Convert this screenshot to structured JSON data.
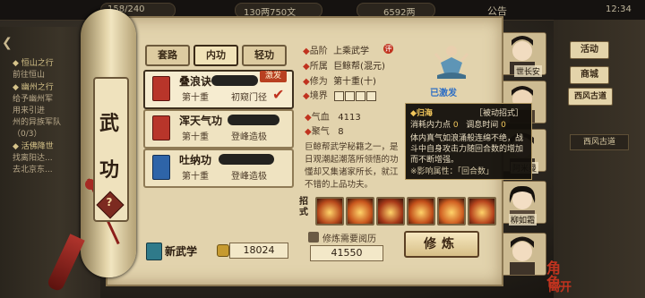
{
  "top_bar": {
    "resource_1": "158/240",
    "resource_2": "130两750文",
    "resource_3": "6592两",
    "announcement": "公告",
    "clock": "12:34"
  },
  "quest_panel": {
    "lines": [
      {
        "title": "◆ 恒山之行",
        "sub": "前往恒山"
      },
      {
        "title": "◆ 幽州之行",
        "sub": "给予幽州军"
      },
      {
        "title": "",
        "sub": "用来引进"
      },
      {
        "title": "",
        "sub": "州的异族军队"
      },
      {
        "title": "",
        "sub": "（0/3）"
      },
      {
        "title": "◆ 活佛降世",
        "sub": "找离阳达..."
      },
      {
        "title": "",
        "sub": "去北京东..."
      }
    ]
  },
  "scroll": {
    "vertical_title": [
      "武",
      "功"
    ],
    "help": "?"
  },
  "tabs": [
    {
      "label": "套路",
      "active": false
    },
    {
      "label": "内功",
      "active": true
    },
    {
      "label": "轻功",
      "active": false
    }
  ],
  "skills": [
    {
      "name": "叠浪诀",
      "tier": "第十重",
      "rank": "初窥门径",
      "badge": "激发",
      "book_color": "#b8352a",
      "selected": true
    },
    {
      "name": "浑天气功",
      "tier": "第十重",
      "rank": "登峰造极",
      "badge": "",
      "book_color": "#b8352a",
      "selected": false
    },
    {
      "name": "吐纳功",
      "tier": "第十重",
      "rank": "登峰造极",
      "badge": "",
      "book_color": "#2e64a8",
      "selected": false
    }
  ],
  "learn": {
    "label": "新武学",
    "coins": "18024"
  },
  "detail": {
    "grade_label": "品阶",
    "grade_value": "上乘武学",
    "grade_badge": "评",
    "owner_label": "所属",
    "owner_value": "巨鲸帮(混元)",
    "cultivation_label": "修为",
    "cultivation_value": "第十重(十)",
    "realm_label": "境界",
    "learned": "已激发",
    "hp_label": "气血",
    "hp_value": "4113",
    "focus_label": "聚气",
    "focus_value": "8",
    "description": [
      "巨鲸帮武学秘籍之一，是",
      "日观潮起潮落所领悟的功",
      "懂却又集诸家所长，就江",
      "不错的上品功夫。"
    ],
    "moves_label": "招式",
    "cost_label": "修炼需要阅历",
    "cost_value": "41550",
    "train_button": "修炼"
  },
  "moves": [
    {
      "icon": "flame-strike-icon",
      "bg": "#b84a1c"
    },
    {
      "icon": "fire-burst-icon",
      "bg": "#c8561d"
    },
    {
      "icon": "ember-palm-icon",
      "bg": "#a83a19"
    },
    {
      "icon": "blaze-wave-icon",
      "bg": "#c24f1a"
    },
    {
      "icon": "inferno-icon",
      "bg": "#d06022"
    },
    {
      "icon": "phoenix-fire-icon",
      "bg": "#b8461e"
    }
  ],
  "tooltip": {
    "title": "◆归海",
    "type": "［被动招式］",
    "cost_label": "消耗内力点",
    "cost_value": "0",
    "cd_label": "调息时间",
    "cd_value": "0",
    "lines": [
      "体内真气如浪涌般连绵不绝，战",
      "斗中自身攻击力随回合数的增加",
      "而不断增强。",
      "※影响属性：「回合数」"
    ]
  },
  "right_menu": {
    "buttons": [
      "活动",
      "商城",
      "西风古道"
    ],
    "location": "西风古道"
  },
  "portraits": [
    {
      "name": "世长安"
    },
    {
      "name": ""
    },
    {
      "name": "阿米曼"
    },
    {
      "name": "柳如霜"
    },
    {
      "name": ""
    }
  ],
  "team_badge": "角色",
  "leave_badge": "离开",
  "colors": {
    "accent_red": "#c0331f",
    "parchment": "#e2d3ad",
    "learned_blue": "#2f6fc4"
  }
}
